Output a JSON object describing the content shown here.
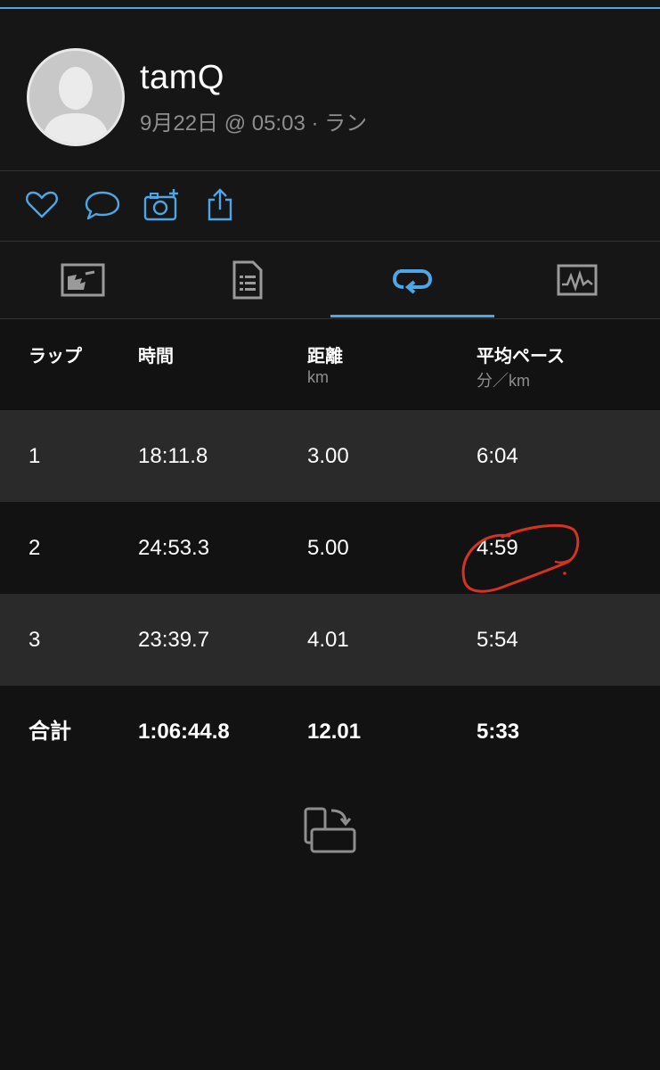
{
  "profile": {
    "username": "tamQ",
    "subtitle": "9月22日 @ 05:03 · ラン"
  },
  "actions": [
    "heart-icon",
    "comment-icon",
    "add-photo-icon",
    "share-icon"
  ],
  "tabs": [
    {
      "icon": "chart-icon",
      "active": false
    },
    {
      "icon": "document-icon",
      "active": false
    },
    {
      "icon": "laps-loop-icon",
      "active": true
    },
    {
      "icon": "activity-graph-icon",
      "active": false
    }
  ],
  "table": {
    "headers": [
      {
        "label": "ラップ",
        "unit": ""
      },
      {
        "label": "時間",
        "unit": ""
      },
      {
        "label": "距離",
        "unit": "km"
      },
      {
        "label": "平均ペース",
        "unit": "分／km"
      }
    ],
    "rows": [
      [
        "1",
        "18:11.8",
        "3.00",
        "6:04"
      ],
      [
        "2",
        "24:53.3",
        "5.00",
        "4:59"
      ],
      [
        "3",
        "23:39.7",
        "4.01",
        "5:54"
      ]
    ],
    "total": [
      "合計",
      "1:06:44.8",
      "12.01",
      "5:33"
    ]
  },
  "annotation": {
    "color": "#d5331f",
    "target": "table.rows.1.3"
  },
  "colors": {
    "accent": "#4ea6e6",
    "background": "#121212",
    "row_dark": "#2a2a2a",
    "muted": "#8e8e8e"
  }
}
